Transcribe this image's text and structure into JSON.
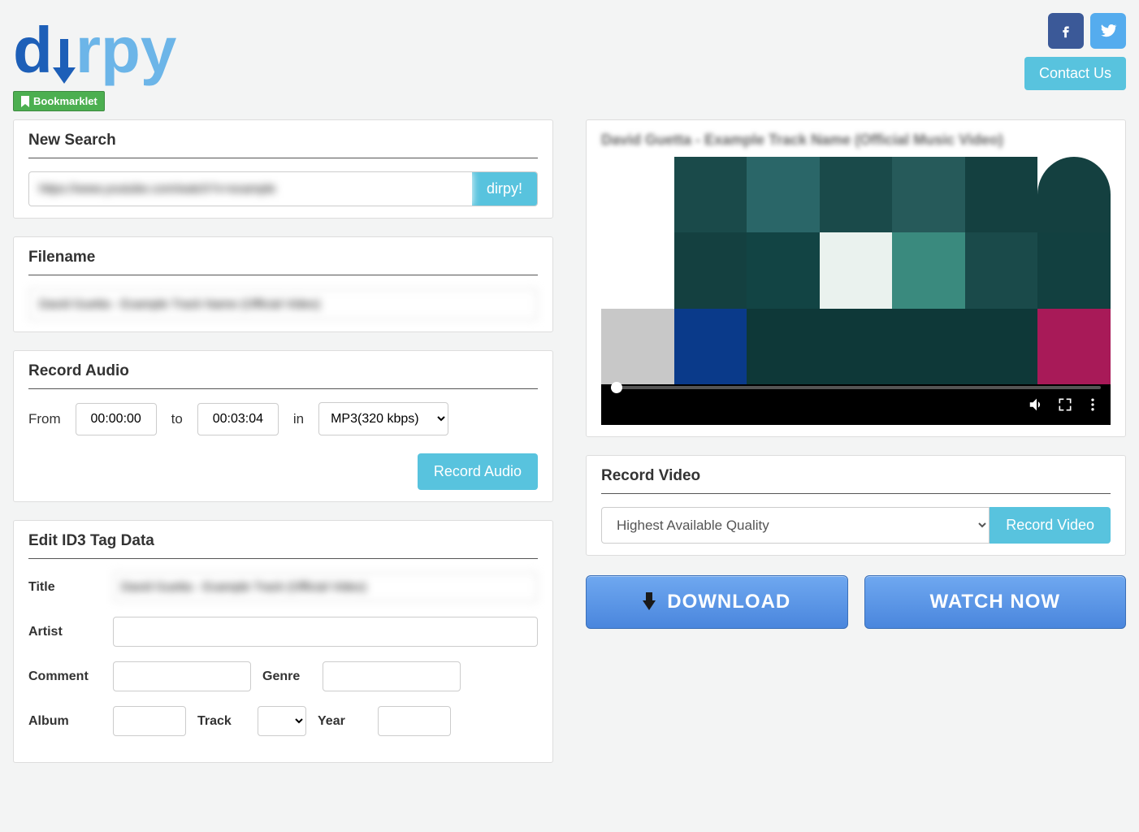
{
  "header": {
    "logo_part1": "d",
    "logo_part2": "rpy",
    "bookmarklet": "Bookmarklet",
    "contact": "Contact Us"
  },
  "search": {
    "title": "New Search",
    "value": "https://www.youtube.com/watch?v=example",
    "button": "dirpy!"
  },
  "filename": {
    "title": "Filename",
    "value": "David Guetta - Example Track Name (Official Video)"
  },
  "record_audio": {
    "title": "Record Audio",
    "from_label": "From",
    "from_value": "00:00:00",
    "to_label": "to",
    "to_value": "00:03:04",
    "in_label": "in",
    "format": "MP3(320 kbps)",
    "button": "Record Audio"
  },
  "id3": {
    "title": "Edit ID3 Tag Data",
    "title_label": "Title",
    "title_value": "David Guetta - Example Track (Official Video)",
    "artist_label": "Artist",
    "artist_value": "",
    "comment_label": "Comment",
    "comment_value": "",
    "genre_label": "Genre",
    "genre_value": "",
    "album_label": "Album",
    "album_value": "",
    "track_label": "Track",
    "track_value": "",
    "year_label": "Year",
    "year_value": ""
  },
  "video": {
    "title_text": "David Guetta - Example Track Name (Official Music Video)"
  },
  "record_video": {
    "title": "Record Video",
    "quality": "Highest Available Quality",
    "button": "Record Video"
  },
  "bottom": {
    "download": "DOWNLOAD",
    "watch": "WATCH NOW"
  }
}
